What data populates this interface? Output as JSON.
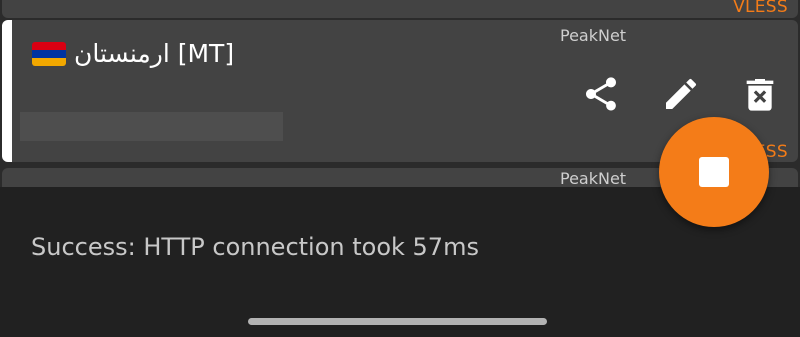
{
  "colors": {
    "accent": "#f47c18",
    "card": "#434343",
    "list_background": "#2b2b2b",
    "snackbar": "#212121"
  },
  "servers": [
    {
      "type": "VLESS"
    },
    {
      "group": "PeakNet",
      "name": "ارمنستان [MT]",
      "flag_icon": "armenia-flag-icon",
      "type": "VLESS",
      "selected": true,
      "actions": [
        {
          "icon": "share-icon"
        },
        {
          "icon": "edit-pencil-icon"
        },
        {
          "icon": "delete-icon"
        }
      ]
    },
    {
      "group": "PeakNet"
    }
  ],
  "fab": {
    "icon": "stop-icon",
    "state": "connected"
  },
  "snackbar": {
    "message": "Success: HTTP connection took 57ms"
  }
}
